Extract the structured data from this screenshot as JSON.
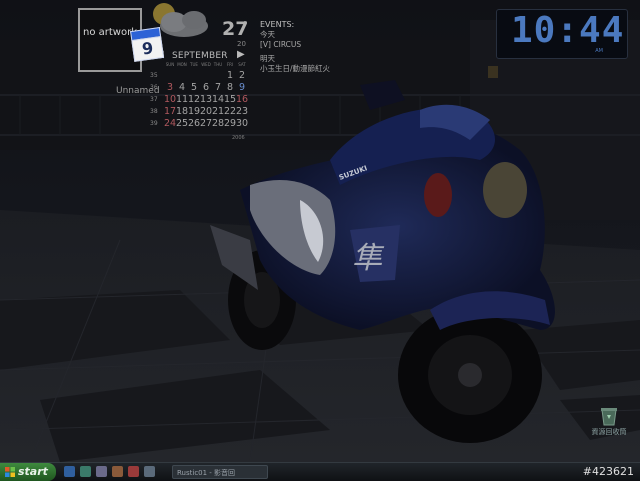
{
  "album_widget": {
    "artwork_text": "no artwork",
    "track_name": "Unnamed"
  },
  "calendar_icon": {
    "day": "9"
  },
  "weather": {
    "temperature": "27",
    "unit": "°",
    "low": "20"
  },
  "calendar": {
    "month": "SEPTEMBER",
    "prev": "◀",
    "next": "▶",
    "weekdays": [
      "SUN",
      "MON",
      "TUE",
      "WED",
      "THU",
      "FRI",
      "SAT"
    ],
    "weeks": [
      {
        "week": "35",
        "days": [
          "",
          "",
          "",
          "",
          "",
          "1",
          "2"
        ]
      },
      {
        "week": "36",
        "days": [
          "3",
          "4",
          "5",
          "6",
          "7",
          "8",
          "9"
        ]
      },
      {
        "week": "37",
        "days": [
          "10",
          "11",
          "12",
          "13",
          "14",
          "15",
          "16"
        ]
      },
      {
        "week": "38",
        "days": [
          "17",
          "18",
          "19",
          "20",
          "21",
          "22",
          "23"
        ]
      },
      {
        "week": "39",
        "days": [
          "24",
          "25",
          "26",
          "27",
          "28",
          "29",
          "30"
        ]
      }
    ],
    "year": "2006"
  },
  "events": {
    "header": "EVENTS:",
    "today_label": "今天",
    "today_item": "[V] CIRCUS",
    "tomorrow_label": "明天",
    "tomorrow_item": "小玉生日/動漫節紅火"
  },
  "clock": {
    "time": "10:44",
    "tag": "AM"
  },
  "desktop": {
    "recycle_bin_label": "資源回收筒"
  },
  "taskbar": {
    "start_label": "start",
    "task_label": "Rustic01 - 影音回",
    "tray_code": "#423621"
  },
  "colors": {
    "clock_blue": "#4b79bf",
    "start_green": "#3e8a3e"
  }
}
